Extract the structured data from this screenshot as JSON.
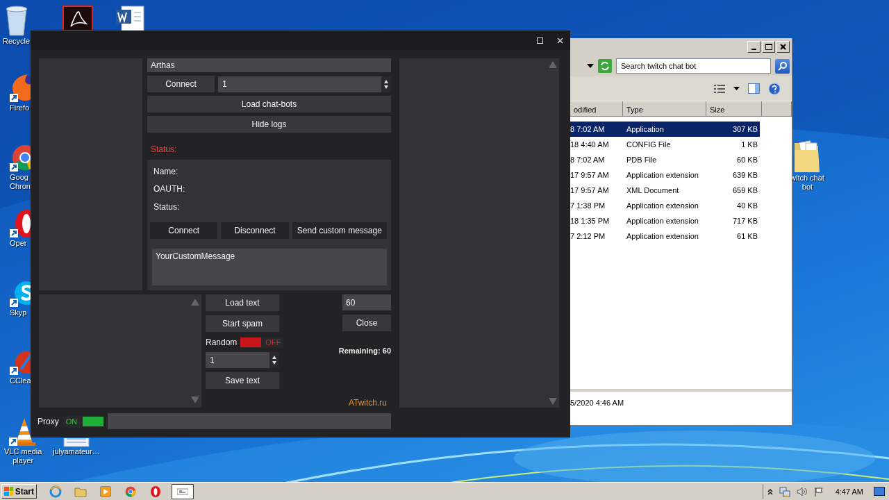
{
  "desktop": {
    "icons": [
      {
        "kind": "recycle",
        "lines": [
          "Recycle"
        ]
      },
      {
        "kind": "pdf"
      },
      {
        "kind": "word"
      },
      {
        "kind": "firefox",
        "lines": [
          "Firefo"
        ]
      },
      {
        "kind": "chrome",
        "lines": [
          "Goog",
          "Chron"
        ]
      },
      {
        "kind": "opera",
        "lines": [
          "Oper"
        ]
      },
      {
        "kind": "skype",
        "lines": [
          "Skyp"
        ]
      },
      {
        "kind": "ccleaner",
        "lines": [
          "CClea"
        ]
      },
      {
        "kind": "vlc",
        "lines": [
          "VLC media",
          "player"
        ]
      },
      {
        "kind": "document",
        "lines": [
          "julyamateur…"
        ]
      },
      {
        "kind": "folder",
        "lines": [
          "witch chat",
          "bot"
        ]
      }
    ]
  },
  "app": {
    "channel_field": {
      "value": "Arthas"
    },
    "connect_button": "Connect",
    "bot_count": {
      "value": "1"
    },
    "buttons": [
      "Load chat-bots",
      "Hide logs"
    ],
    "status_label": "Status:",
    "bot": {
      "fields": [
        "Name:",
        "OAUTH:",
        "Status:"
      ],
      "buttons": [
        "Connect",
        "Disconnect",
        "Send custom message"
      ],
      "message": {
        "value": "YourCustomMessage"
      }
    },
    "spam": {
      "load_button": "Load text",
      "start_button": "Start spam",
      "random": {
        "label": "Random",
        "on": false,
        "state_text": "OFF"
      },
      "repeat": {
        "value": "1"
      },
      "save_button": "Save text"
    },
    "timer": {
      "value": "60"
    },
    "close_button": "Close",
    "remaining": "Remaining: 60",
    "site": "ATwitch.ru",
    "proxy": {
      "label": "Proxy",
      "on": true,
      "state_text": "ON"
    }
  },
  "explorer": {
    "search": {
      "placeholder": "Search twitch chat bot"
    },
    "columns": [
      "odified",
      "Type",
      "Size"
    ],
    "rows": [
      {
        "modified": "8 7:02 AM",
        "type": "Application",
        "size": "307 KB",
        "selected": true
      },
      {
        "modified": "18 4:40 AM",
        "type": "CONFIG File",
        "size": "1 KB",
        "selected": false
      },
      {
        "modified": "8 7:02 AM",
        "type": "PDB File",
        "size": "60 KB",
        "selected": false
      },
      {
        "modified": "17 9:57 AM",
        "type": "Application extension",
        "size": "639 KB",
        "selected": false
      },
      {
        "modified": "17 9:57 AM",
        "type": "XML Document",
        "size": "659 KB",
        "selected": false
      },
      {
        "modified": "7 1:38 PM",
        "type": "Application extension",
        "size": "40 KB",
        "selected": false
      },
      {
        "modified": "18 1:35 PM",
        "type": "Application extension",
        "size": "717 KB",
        "selected": false
      },
      {
        "modified": "7 2:12 PM",
        "type": "Application extension",
        "size": "61 KB",
        "selected": false
      }
    ],
    "details": "5/2020 4:46 AM"
  },
  "taskbar": {
    "start": "Start",
    "apps": [
      {
        "kind": "ie",
        "selected": false
      },
      {
        "kind": "explorer",
        "selected": false
      },
      {
        "kind": "media",
        "selected": false
      },
      {
        "kind": "chrome",
        "selected": false
      },
      {
        "kind": "opera",
        "selected": false
      },
      {
        "kind": "app",
        "selected": true
      }
    ],
    "clock": "4:47 AM"
  }
}
